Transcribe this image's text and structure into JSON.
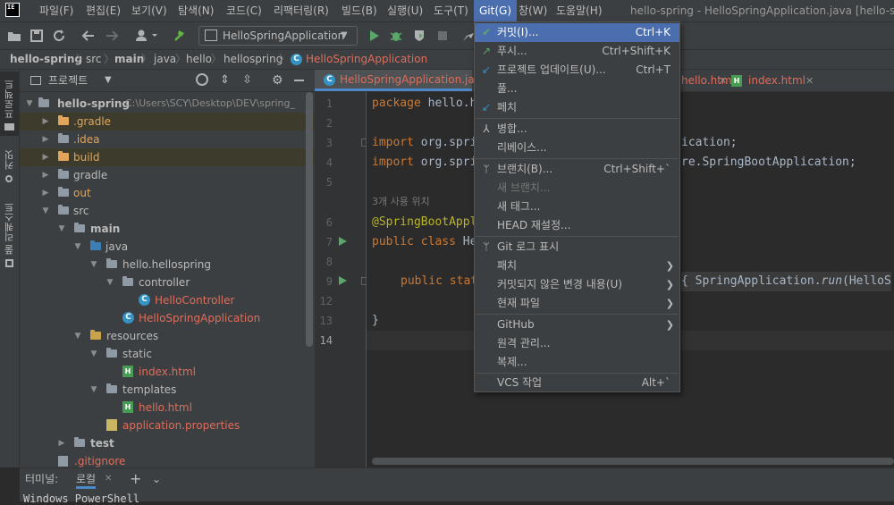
{
  "menubar": {
    "logo_text": "IE",
    "items": [
      "파일(F)",
      "편집(E)",
      "보기(V)",
      "탐색(N)",
      "코드(C)",
      "리팩터링(R)",
      "빌드(B)",
      "실행(U)",
      "도구(T)",
      "Git(G)",
      "창(W)",
      "도움말(H)"
    ],
    "window_title": "hello-spring - HelloSpringApplication.java [hello-spring]"
  },
  "toolbar": {
    "run_config": "HelloSpringApplication"
  },
  "breadcrumb": [
    "hello-spring",
    "src",
    "main",
    "java",
    "hello",
    "hellospring",
    "HelloSpringApplication"
  ],
  "left_stripe": {
    "project_tab": "프로젝트",
    "commit_tab": "커밋",
    "pull_requests_tab": "풀 리퀘스트"
  },
  "project_panel": {
    "title": "프로젝트",
    "root_name": "hello-spring",
    "root_path": "C:\\Users\\SCY\\Desktop\\DEV\\spring_",
    "items": [
      {
        "label": ".gradle"
      },
      {
        "label": ".idea"
      },
      {
        "label": "build"
      },
      {
        "label": "gradle"
      },
      {
        "label": "out"
      },
      {
        "label": "src"
      },
      {
        "label": "main"
      },
      {
        "label": "java"
      },
      {
        "label": "hello.hellospring"
      },
      {
        "label": "controller"
      },
      {
        "label": "HelloController"
      },
      {
        "label": "HelloSpringApplication"
      },
      {
        "label": "resources"
      },
      {
        "label": "static"
      },
      {
        "label": "index.html"
      },
      {
        "label": "templates"
      },
      {
        "label": "hello.html"
      },
      {
        "label": "application.properties"
      },
      {
        "label": "test"
      },
      {
        "label": ".gitignore"
      }
    ]
  },
  "editor": {
    "tabs": [
      {
        "label": "HelloSpringApplication.java"
      },
      {
        "label": "hello.html"
      },
      {
        "label": "index.html"
      }
    ],
    "line_numbers": [
      "1",
      "2",
      "3",
      "4",
      "5",
      "6",
      "7",
      "8",
      "9",
      "12",
      "13",
      "14"
    ],
    "usage_hint": "3개 사용 위치",
    "code": {
      "l1_kw": "package",
      "l1_rest": " hello.h",
      "l3_kw": "import",
      "l3_rest": " org.spri",
      "l3_tail": "ication;",
      "l4_kw": "import",
      "l4_rest": " org.spri",
      "l4_tail_a": "re.",
      "l4_tail_b": "SpringBootApplication",
      "l4_tail_c": ";",
      "l6_ann": "@SpringBootAppl",
      "l7_kw": "public class",
      "l7_rest": " He",
      "l9_kw": "public stat",
      "l9_tail_a": "{ SpringApplication.",
      "l9_tail_b": "run",
      "l9_tail_c": "(HelloS",
      "l13": "}"
    }
  },
  "terminal": {
    "title": "터미널:",
    "tab": "로컬",
    "first_line": "Windows PowerShell"
  },
  "git_menu": {
    "items": [
      {
        "label": "커밋(I)...",
        "shortcut": "Ctrl+K"
      },
      {
        "label": "푸시...",
        "shortcut": "Ctrl+Shift+K"
      },
      {
        "label": "프로젝트 업데이트(U)...",
        "shortcut": "Ctrl+T"
      },
      {
        "label": "풀..."
      },
      {
        "label": "페치"
      },
      {
        "label": "병합..."
      },
      {
        "label": "리베이스..."
      },
      {
        "label": "브랜치(B)...",
        "shortcut": "Ctrl+Shift+`"
      },
      {
        "label": "새 브랜치..."
      },
      {
        "label": "새 태그..."
      },
      {
        "label": "HEAD 재설정..."
      },
      {
        "label": "Git 로그 표시"
      },
      {
        "label": "패치"
      },
      {
        "label": "커밋되지 않은 변경 내용(U)"
      },
      {
        "label": "현재 파일"
      },
      {
        "label": "GitHub"
      },
      {
        "label": "원격 관리..."
      },
      {
        "label": "복제..."
      },
      {
        "label": "VCS 작업",
        "shortcut": "Alt+`"
      }
    ]
  },
  "colors": {
    "accent": "#4b6eaf",
    "excluded_folder": "#e0a45a",
    "modified_file": "#e06c5a",
    "folder": "#8f9aa5",
    "java_class": "#3592c4"
  }
}
